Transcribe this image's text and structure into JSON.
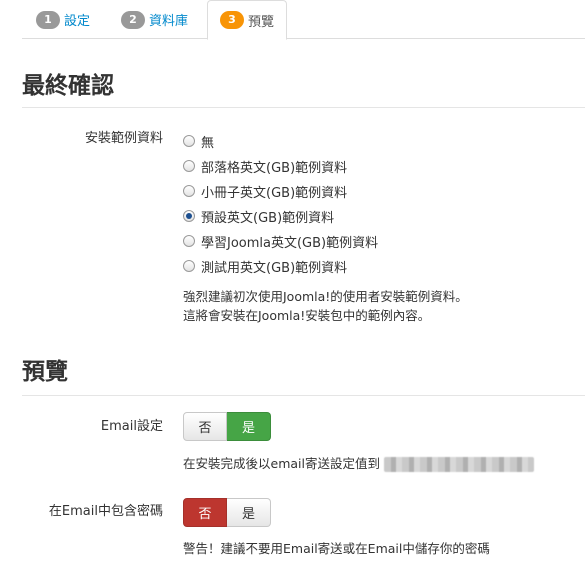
{
  "tabs": [
    {
      "num": "1",
      "label": "設定"
    },
    {
      "num": "2",
      "label": "資料庫"
    },
    {
      "num": "3",
      "label": "預覽"
    }
  ],
  "final": {
    "heading": "最終確認",
    "sample_label": "安裝範例資料",
    "options": [
      {
        "label": "無",
        "checked": false
      },
      {
        "label": "部落格英文(GB)範例資料",
        "checked": false
      },
      {
        "label": "小冊子英文(GB)範例資料",
        "checked": false
      },
      {
        "label": "預設英文(GB)範例資料",
        "checked": true
      },
      {
        "label": "學習Joomla英文(GB)範例資料",
        "checked": false
      },
      {
        "label": "測試用英文(GB)範例資料",
        "checked": false
      }
    ],
    "help_line1": "強烈建議初次使用Joomla!的使用者安裝範例資料。",
    "help_line2": "這將會安裝在Joomla!安裝包中的範例內容。"
  },
  "preview": {
    "heading": "預覽",
    "email_label": "Email設定",
    "email_no": "否",
    "email_yes": "是",
    "email_selected": "yes",
    "email_help": "在安裝完成後以email寄送設定值到",
    "password_label": "在Email中包含密碼",
    "password_no": "否",
    "password_yes": "是",
    "password_selected": "no",
    "password_help": "警告！建議不要用Email寄送或在Email中儲存你的密碼"
  },
  "colors": {
    "link": "#0088cc",
    "active_badge": "#f89406",
    "inactive_badge": "#999999",
    "yes_selected": "#46a546",
    "no_selected": "#bd362f"
  }
}
